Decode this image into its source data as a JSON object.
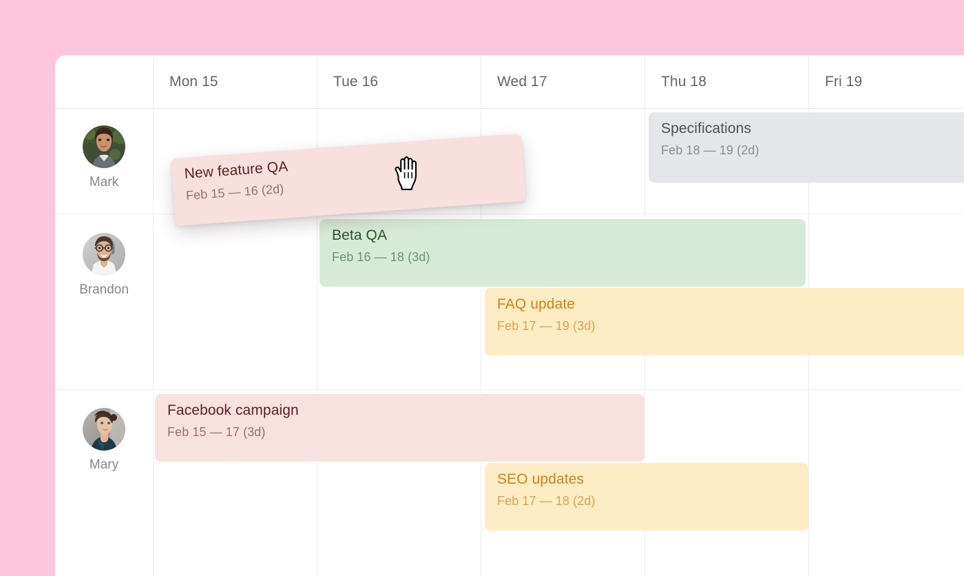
{
  "app": {
    "background_color": "#ffc5dd",
    "board_color": "#ffffff"
  },
  "timeline": {
    "resource_column_header": "",
    "columns": [
      {
        "label": "Mon 15",
        "name": "mon-15"
      },
      {
        "label": "Tue 16",
        "name": "tue-16"
      },
      {
        "label": "Wed 17",
        "name": "wed-17"
      },
      {
        "label": "Thu 18",
        "name": "thu-18"
      },
      {
        "label": "Fri 19",
        "name": "fri-19"
      }
    ],
    "resources": [
      {
        "name": "Mark",
        "avatar": "avatar-mark"
      },
      {
        "name": "Brandon",
        "avatar": "avatar-brandon"
      },
      {
        "name": "Mary",
        "avatar": "avatar-mary"
      }
    ],
    "tasks": [
      {
        "title": "Specifications",
        "start": "Feb 18",
        "dash": "—",
        "end": "19",
        "duration": "(2d)",
        "dates": "Feb 18  — 19 (2d)",
        "resource": "Mark",
        "theme": "gray",
        "color": "#e4e6e9",
        "dragging": false
      },
      {
        "title": "New feature QA",
        "start": "Feb 15",
        "dash": "—",
        "end": "16",
        "duration": "(2d)",
        "dates": "Feb 15  — 16 (2d)",
        "resource": "Mark",
        "theme": "pink",
        "color": "#f7e0de",
        "dragging": true
      },
      {
        "title": "Beta QA",
        "start": "Feb 16",
        "dash": "—",
        "end": "18",
        "duration": "(3d)",
        "dates": "Feb 16  — 18 (3d)",
        "resource": "Brandon",
        "theme": "green",
        "color": "#d7ead7",
        "dragging": false
      },
      {
        "title": "FAQ update",
        "start": "Feb 17",
        "dash": "—",
        "end": "19",
        "duration": "(3d)",
        "dates": "Feb 17  — 19 (3d)",
        "resource": "Brandon",
        "theme": "yellow",
        "color": "#fdecc4",
        "dragging": false
      },
      {
        "title": "Facebook campaign",
        "start": "Feb 15",
        "dash": "—",
        "end": "17",
        "duration": "(3d)",
        "dates": "Feb 15  — 17 (3d)",
        "resource": "Mary",
        "theme": "pink",
        "color": "#f8e2e0",
        "dragging": false
      },
      {
        "title": "SEO updates",
        "start": "Feb 17",
        "dash": "—",
        "end": "18",
        "duration": "(2d)",
        "dates": "Feb 17  — 18 (2d)",
        "resource": "Mary",
        "theme": "yellow",
        "color": "#fdecc4",
        "dragging": false
      }
    ]
  },
  "cursor": {
    "icon": "grab-hand-cursor",
    "state": "dragging"
  }
}
